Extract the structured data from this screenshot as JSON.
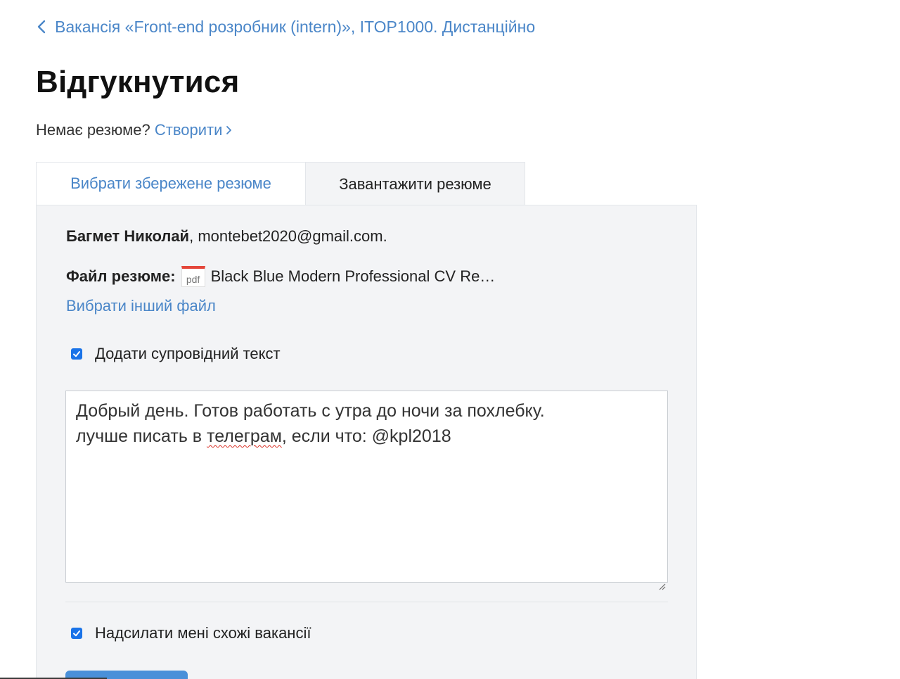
{
  "back_link": {
    "text": "Вакансія «Front-end розробник (intern)», ITOP1000. Дистанційно"
  },
  "page_title": "Відгукнутися",
  "no_resume": {
    "question": "Немає резюме?",
    "create_label": "Створити"
  },
  "tabs": [
    {
      "label": "Вибрати збережене резюме",
      "active": false
    },
    {
      "label": "Завантажити резюме",
      "active": true
    }
  ],
  "applicant": {
    "name": "Багмет Николай",
    "separator": ",",
    "email": "montebet2020@gmail.com."
  },
  "resume_file": {
    "label": "Файл резюме:",
    "icon_text": "pdf",
    "file_name": "Black Blue Modern Professional CV Re…",
    "choose_other_label": "Вибрати інший файл"
  },
  "cover_letter": {
    "checkbox_label": "Додати супровідний текст",
    "checked": true,
    "text_line1": "Добрый день. Готов работать с утра до ночи за похлебку.",
    "text_line2_before": "лучше писать в ",
    "text_line2_misspelled": "телеграм",
    "text_line2_after": ", если что: @kpl2018"
  },
  "similar_jobs": {
    "checkbox_label": "Надсилати мені схожі вакансії",
    "checked": true
  },
  "colors": {
    "link": "#4a86c8",
    "panel_bg": "#f3f4f6",
    "checkbox": "#1a73e8",
    "button": "#4a90d9",
    "pdf_accent": "#e4463a"
  }
}
